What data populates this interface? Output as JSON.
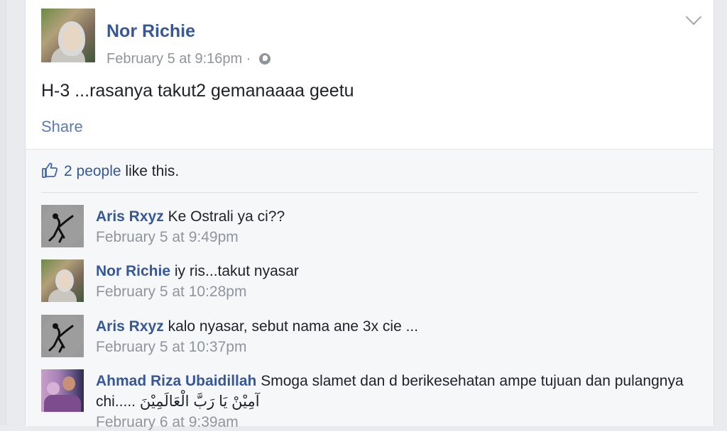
{
  "post": {
    "author": "Nor Richie",
    "timestamp": "February 5 at 9:16pm",
    "separator": "·",
    "privacy_icon": "globe-icon",
    "text": "H-3 ...rasanya takut2 gemanaaaa geetu",
    "share_label": "Share"
  },
  "likes": {
    "count_text": "2 people",
    "suffix": " like this."
  },
  "comments": [
    {
      "author": "Aris Rxyz",
      "text": "Ke Ostrali ya ci??",
      "time": "February 5 at 9:49pm"
    },
    {
      "author": "Nor Richie",
      "text": "iy ris...takut nyasar",
      "time": "February 5 at 10:28pm"
    },
    {
      "author": "Aris Rxyz",
      "text": "kalo nyasar, sebut nama ane 3x cie ...",
      "time": "February 5 at 10:37pm"
    },
    {
      "author": "Ahmad Riza Ubaidillah",
      "text": "Smoga slamet dan d berikesehatan ampe tujuan dan pulangnya chi..... آمِيْنْ يَا رَبَّ الْعَالَمِيْنَ",
      "time": "February 6 at 9:39am"
    }
  ],
  "colors": {
    "link": "#365899",
    "muted": "#90949c",
    "text": "#1d2129",
    "page_bg": "#e9ebee"
  }
}
